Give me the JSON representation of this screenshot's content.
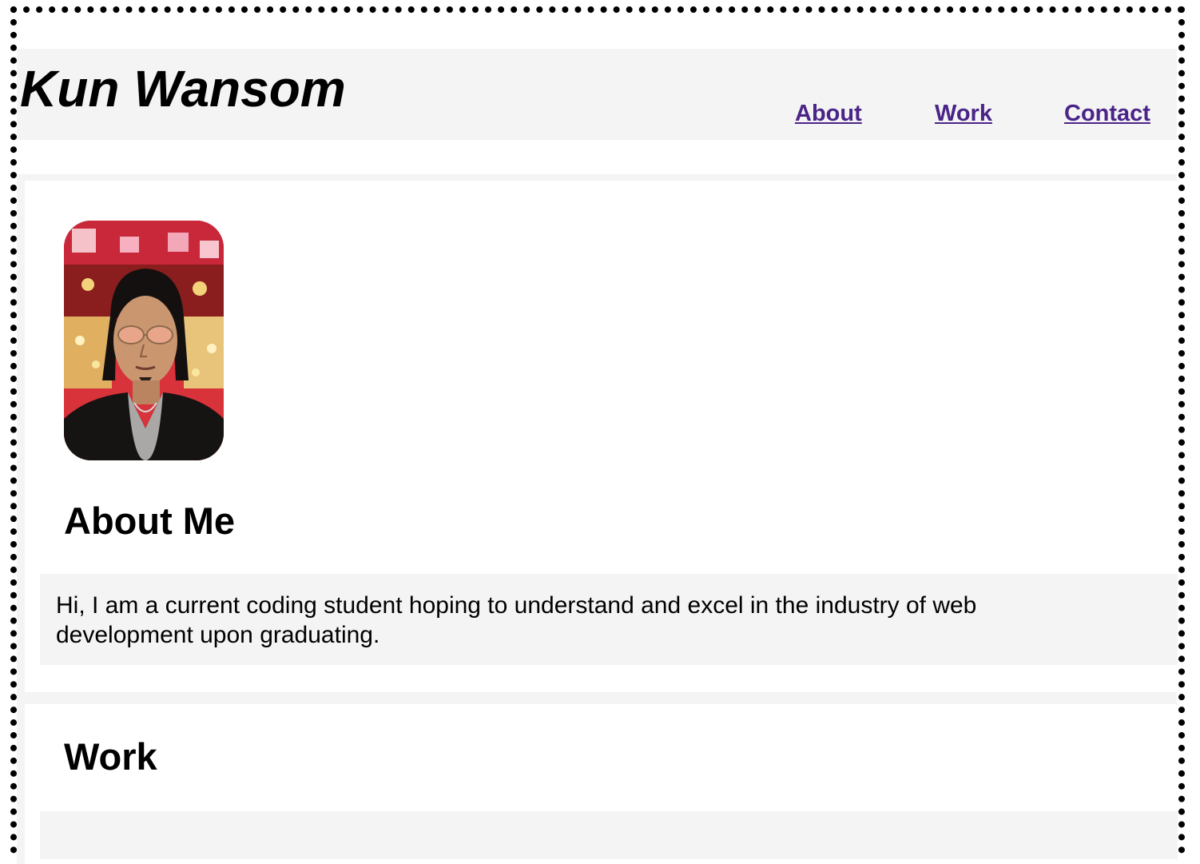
{
  "header": {
    "title": "Kun Wansom",
    "nav": [
      {
        "label": "About"
      },
      {
        "label": "Work"
      },
      {
        "label": "Contact"
      }
    ]
  },
  "about": {
    "avatar_alt": "Portrait photo of Kun Wansom",
    "heading": "About Me",
    "text": "Hi, I am a current coding student hoping to understand and excel in the industry of web development upon graduating."
  },
  "work": {
    "heading": "Work"
  },
  "colors": {
    "link": "#4b2488",
    "panel_background": "#f4f4f4",
    "border": "#000000"
  }
}
